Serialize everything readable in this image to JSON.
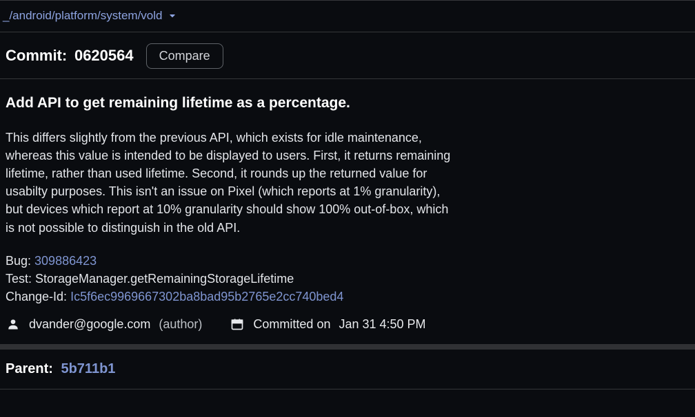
{
  "breadcrumb": {
    "path": "_/android/platform/system/vold"
  },
  "commit": {
    "label": "Commit:",
    "hash": "0620564",
    "compare_label": "Compare"
  },
  "message": {
    "title": "Add API to get remaining lifetime as a percentage.",
    "body": "This differs slightly from the previous API, which exists for idle maintenance, whereas this value is intended to be displayed to users. First, it returns remaining lifetime, rather than used lifetime. Second, it rounds up the returned value for usabilty purposes. This isn't an issue on Pixel (which reports at 1% granularity), but devices which report at 10% granularity should show 100% out-of-box, which is not possible to distinguish in the old API.",
    "bug_label": "Bug: ",
    "bug_id": "309886423",
    "test_line": "Test: StorageManager.getRemainingStorageLifetime",
    "changeid_label": "Change-Id: ",
    "changeid_value": "Ic5f6ec9969667302ba8bad95b2765e2cc740bed4"
  },
  "meta": {
    "author_email": "dvander@google.com",
    "author_role": "(author)",
    "committed_label": "Committed on",
    "committed_date": "Jan 31 4:50 PM"
  },
  "parent": {
    "label": "Parent:",
    "hash": "5b711b1"
  }
}
